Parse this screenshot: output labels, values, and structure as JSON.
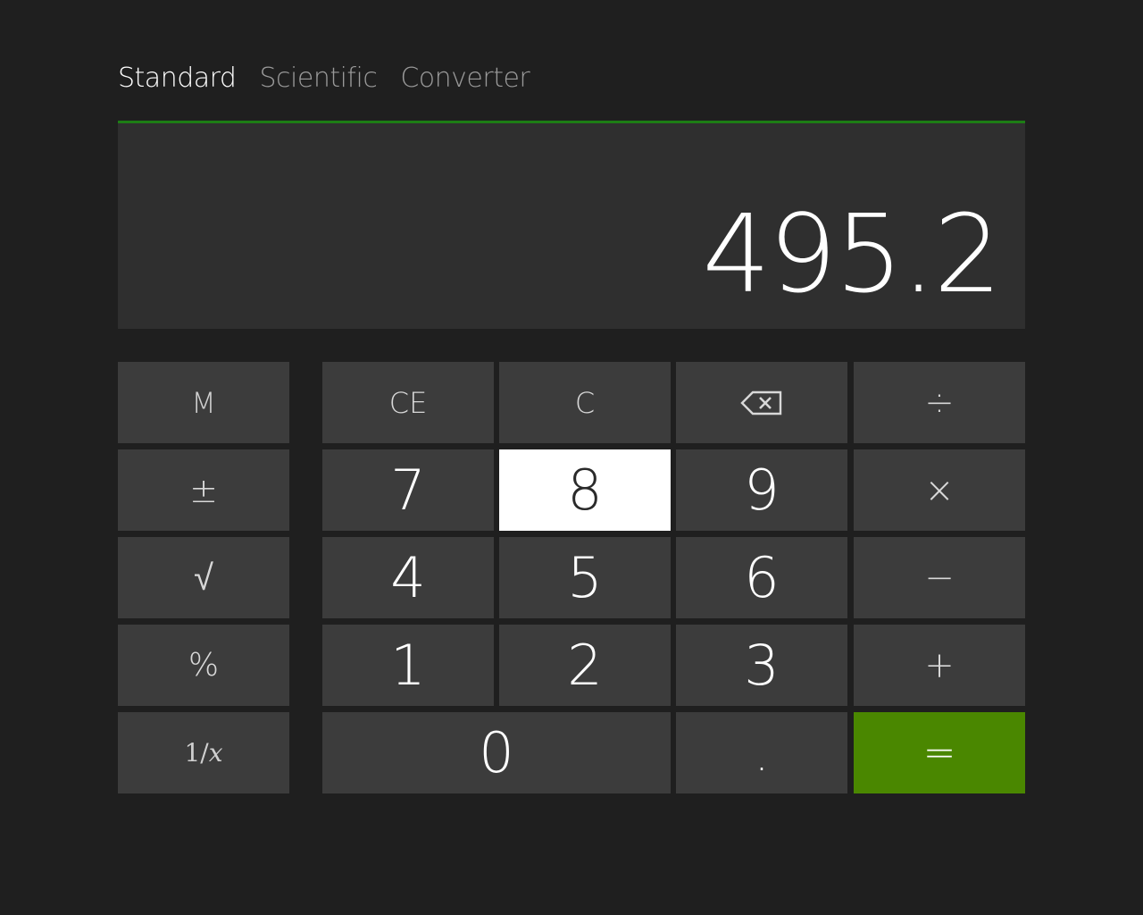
{
  "tabs": [
    {
      "label": "Standard",
      "active": true
    },
    {
      "label": "Scientific",
      "active": false
    },
    {
      "label": "Converter",
      "active": false
    }
  ],
  "display": {
    "value": "495.2"
  },
  "keys": {
    "memory": "M",
    "negate": "±",
    "sqrt": "√",
    "percent": "%",
    "reciprocal_one": "1/",
    "reciprocal_x": "x",
    "clear_entry": "CE",
    "clear": "C",
    "backspace_icon": "backspace-icon",
    "divide": "÷",
    "multiply": "×",
    "subtract": "−",
    "add": "+",
    "equals": "=",
    "decimal": ".",
    "digit_7": "7",
    "digit_8": "8",
    "digit_9": "9",
    "digit_4": "4",
    "digit_5": "5",
    "digit_6": "6",
    "digit_1": "1",
    "digit_2": "2",
    "digit_3": "3",
    "digit_0": "0"
  },
  "colors": {
    "background": "#1f1f1f",
    "display_background": "#2f2f2f",
    "key_background": "#3c3c3c",
    "accent_green": "#4a8700",
    "display_accent_border": "#1d7d15",
    "pressed_key": "#ffffff"
  }
}
